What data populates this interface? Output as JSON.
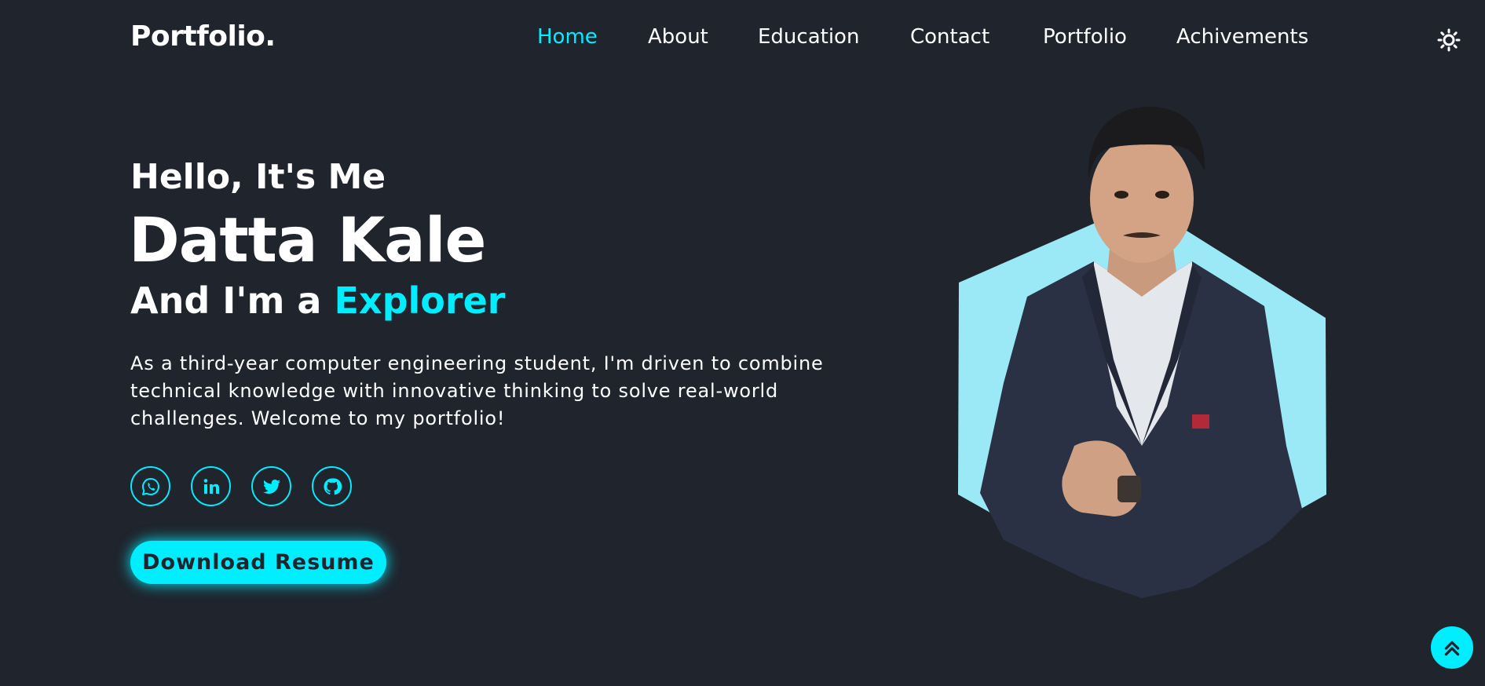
{
  "header": {
    "logo": "Portfolio.",
    "nav": [
      {
        "label": "Home",
        "active": true
      },
      {
        "label": "About"
      },
      {
        "label": "Education"
      },
      {
        "label": "Contact"
      },
      {
        "label": "Portfolio"
      },
      {
        "label": "Achivements"
      }
    ],
    "theme_icon": "sun-icon"
  },
  "hero": {
    "greeting": "Hello, It's Me",
    "name": "Datta Kale",
    "role_prefix": "And I'm a ",
    "role": "Explorer",
    "description": "As a third-year computer engineering student, I'm driven to combine technical knowledge with innovative thinking to solve real-world challenges. Welcome to my portfolio!",
    "socials": [
      "whatsapp-icon",
      "linkedin-icon",
      "twitter-icon",
      "github-icon"
    ],
    "download_label": "Download Resume"
  },
  "colors": {
    "background": "#1f242d",
    "accent": "#00eeff",
    "hexagon": "#9be9f7",
    "text": "#ffffff"
  },
  "scroll_top_icon": "double-chevron-up-icon"
}
